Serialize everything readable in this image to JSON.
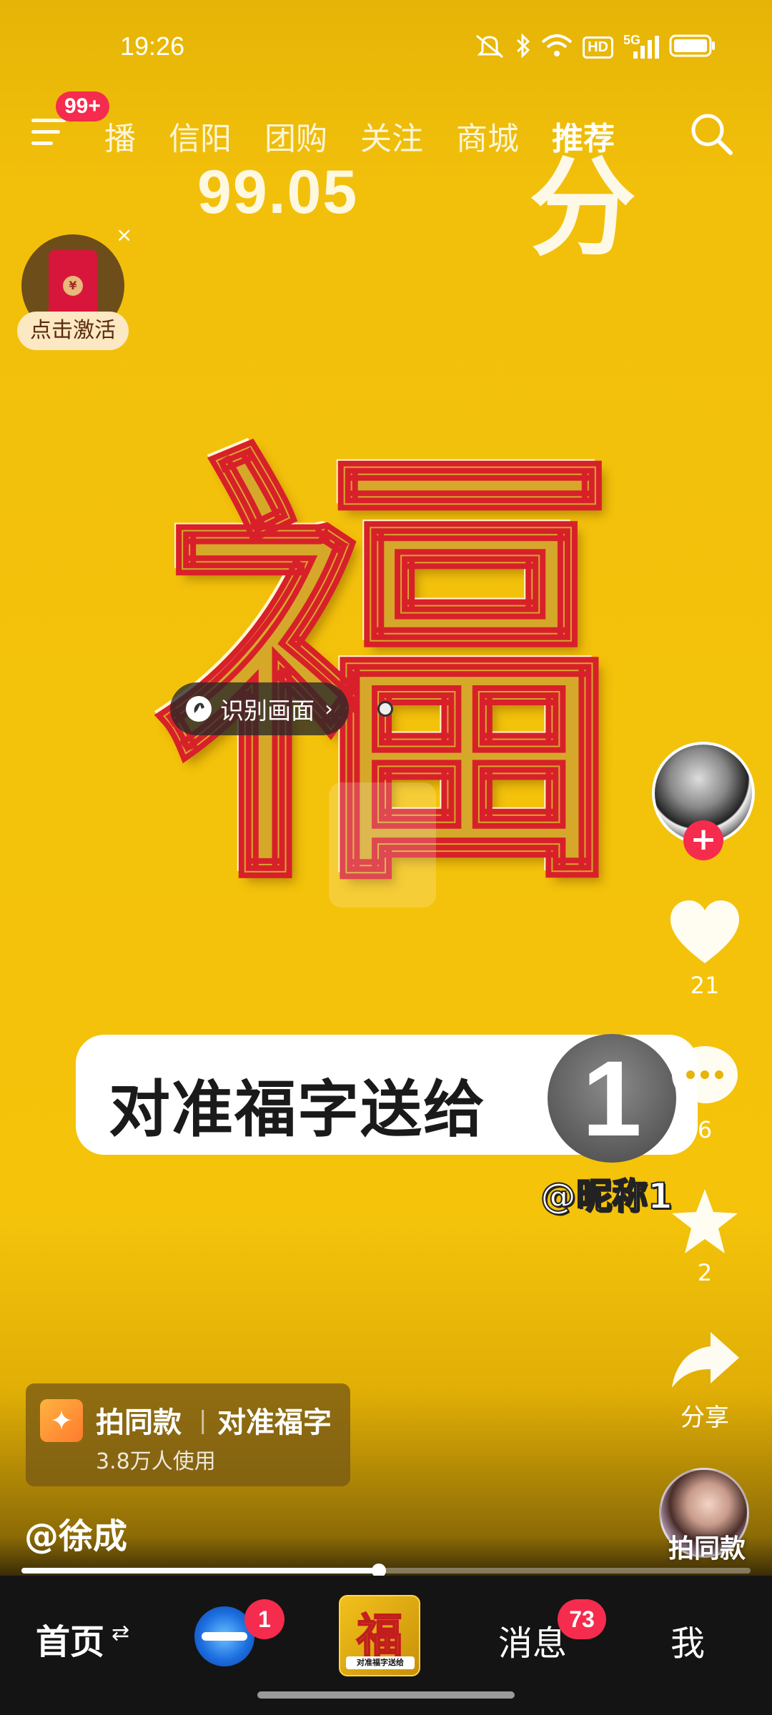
{
  "status_bar": {
    "time": "19:26",
    "icons": [
      "mute-icon",
      "bluetooth-icon",
      "wifi-icon",
      "hd-icon",
      "5g-signal-icon",
      "battery-icon"
    ],
    "hd_label": "HD",
    "net_label": "5G"
  },
  "top_nav": {
    "menu_badge": "99+",
    "tabs": [
      "播",
      "信阳",
      "团购",
      "关注",
      "商城",
      "推荐"
    ],
    "active_tab": "推荐"
  },
  "video_overlay": {
    "score": "99.05",
    "score_unit": "分",
    "fu": "福",
    "caption": "对准福字送给",
    "avatar_number": "1",
    "nickname": "@昵称1"
  },
  "red_packet": {
    "activate_label": "点击激活",
    "close": "×",
    "coin": "¥"
  },
  "identify": {
    "label": "识别画面",
    "chevron": "›"
  },
  "rail": {
    "follow": "+",
    "likes": "21",
    "comments": "6",
    "favorites": "2",
    "share_label": "分享",
    "same_style_label": "拍同款"
  },
  "remix": {
    "icon": "✦",
    "title": "拍同款",
    "separator": "|",
    "name": "对准福字",
    "users": "3.8万人使用"
  },
  "author": "@徐成",
  "progress": {
    "fraction": 0.49
  },
  "bottom_nav": {
    "home": "首页",
    "home_swap": "⇄",
    "friends_badge": "1",
    "center_char": "福",
    "center_caption": "对准福字送给",
    "messages": "消息",
    "messages_badge": "73",
    "me": "我"
  },
  "colors": {
    "background": "#F4C20A",
    "accent_red": "#F52C4D",
    "nav_bg": "#141414"
  }
}
